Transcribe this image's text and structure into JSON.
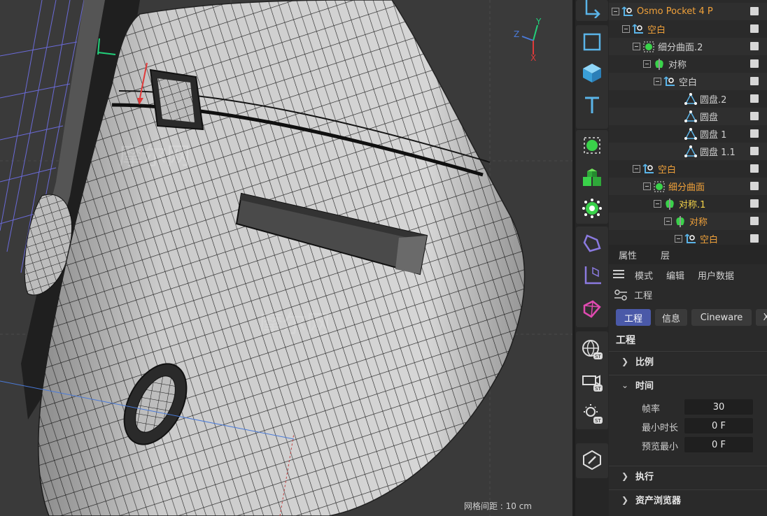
{
  "viewport": {
    "grid_spacing": "网格间距 : 10 cm",
    "axis": {
      "y": "Y",
      "z": "Z",
      "x": "X"
    },
    "colors": {
      "background": "#3a3a3a",
      "mesh_fill": "#d8d8d8",
      "mesh_line": "#1c1c1c",
      "axis_y": "#22d07a",
      "axis_x": "#e03a3a",
      "axis_z": "#4a7ad8"
    }
  },
  "toolbar": {
    "icons": [
      "move-icon",
      "cube-outline-icon",
      "cube-solid-icon",
      "text-icon",
      "subdivision-icon",
      "cloner-icon",
      "deformer-icon",
      "spline-icon",
      "coordinate-icon",
      "mograph-icon",
      "sky-icon",
      "camera-icon",
      "light-icon",
      "edit-icon"
    ]
  },
  "object_manager": {
    "rows": [
      {
        "name": "Osmo Pocket 4 P",
        "indent": 0,
        "icon": "null-icon",
        "color": "orange"
      },
      {
        "name": "空白",
        "indent": 1,
        "icon": "null-icon",
        "color": "orange"
      },
      {
        "name": "细分曲面.2",
        "indent": 2,
        "icon": "subdivision-icon",
        "color": "normal"
      },
      {
        "name": "对称",
        "indent": 3,
        "icon": "symmetry-icon",
        "color": "normal"
      },
      {
        "name": "空白",
        "indent": 4,
        "icon": "null-icon",
        "color": "normal"
      },
      {
        "name": "圆盘.2",
        "indent": 6,
        "icon": "disc-icon",
        "color": "normal"
      },
      {
        "name": "圆盘",
        "indent": 6,
        "icon": "disc-icon",
        "color": "normal"
      },
      {
        "name": "圆盘 1",
        "indent": 6,
        "icon": "disc-icon",
        "color": "normal"
      },
      {
        "name": "圆盘 1.1",
        "indent": 6,
        "icon": "disc-icon",
        "color": "normal"
      },
      {
        "name": "空白",
        "indent": 2,
        "icon": "null-icon",
        "color": "orange"
      },
      {
        "name": "细分曲面",
        "indent": 3,
        "icon": "subdivision-icon",
        "color": "orange"
      },
      {
        "name": "对称.1",
        "indent": 4,
        "icon": "symmetry-icon",
        "color": "yellow"
      },
      {
        "name": "对称",
        "indent": 5,
        "icon": "symmetry-icon",
        "color": "orange"
      },
      {
        "name": "空白",
        "indent": 6,
        "icon": "null-icon",
        "color": "orange"
      }
    ]
  },
  "attributes": {
    "tabs": [
      "属性",
      "层"
    ],
    "menu": [
      "模式",
      "编辑",
      "用户数据"
    ],
    "path": "工程",
    "property_tabs": [
      "工程",
      "信息",
      "Cineware",
      "X"
    ],
    "section_title": "工程",
    "groups": {
      "scale": "比例",
      "time": "时间",
      "execute": "执行",
      "asset_browser": "资产浏览器"
    },
    "params": [
      {
        "label": "帧率",
        "value": "30"
      },
      {
        "label": "最小时长",
        "value": "0 F"
      },
      {
        "label": "预览最小",
        "value": "0 F"
      }
    ]
  }
}
